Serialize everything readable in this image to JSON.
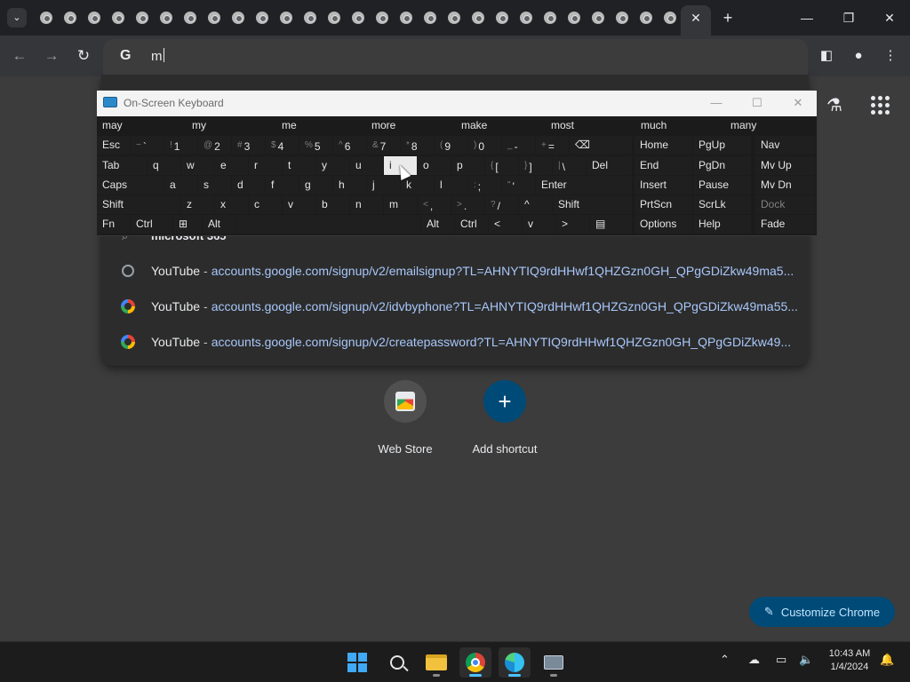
{
  "tabs": {
    "count": 27,
    "active_close": "✕",
    "new_tab": "+"
  },
  "window": {
    "minimize": "—",
    "maximize": "❐",
    "close": "✕"
  },
  "omnibox": {
    "text": "m"
  },
  "suggestions": [
    {
      "icon": "globe",
      "title": "YouTube",
      "sep": "-",
      "url": "accounts.google.com/signup/v2/emailsignup?TL=AHNYTIQ9rdHHwf1QHZGzn0GH_QPgGDiZkw49ma5..."
    },
    {
      "icon": "google",
      "title": "YouTube",
      "sep": "-",
      "url": "accounts.google.com/signup/v2/idvbyphone?TL=AHNYTIQ9rdHHwf1QHZGzn0GH_QPgGDiZkw49ma55..."
    },
    {
      "icon": "google",
      "title": "YouTube",
      "sep": "-",
      "url": "accounts.google.com/signup/v2/createpassword?TL=AHNYTIQ9rdHHwf1QHZGzn0GH_QPgGDiZkw49..."
    }
  ],
  "hidden_suggestion": "microsoft 365",
  "shortcuts": [
    {
      "label": "Web Store"
    },
    {
      "label": "Add shortcut"
    }
  ],
  "customize_label": "Customize Chrome",
  "osk": {
    "title": "On-Screen Keyboard",
    "predictions": [
      "may",
      "my",
      "me",
      "more",
      "make",
      "most",
      "much",
      "many"
    ],
    "row1": [
      {
        "k": "Esc"
      },
      {
        "s": "~",
        "m": "`"
      },
      {
        "s": "!",
        "m": "1"
      },
      {
        "s": "@",
        "m": "2"
      },
      {
        "s": "#",
        "m": "3"
      },
      {
        "s": "$",
        "m": "4"
      },
      {
        "s": "%",
        "m": "5"
      },
      {
        "s": "^",
        "m": "6"
      },
      {
        "s": "&",
        "m": "7"
      },
      {
        "s": "*",
        "m": "8"
      },
      {
        "s": "(",
        "m": "9"
      },
      {
        "s": ")",
        "m": "0"
      },
      {
        "s": "_",
        "m": "-"
      },
      {
        "s": "+",
        "m": "="
      },
      {
        "k": "⌫"
      }
    ],
    "row2": [
      {
        "k": "Tab"
      },
      {
        "k": "q"
      },
      {
        "k": "w"
      },
      {
        "k": "e"
      },
      {
        "k": "r"
      },
      {
        "k": "t"
      },
      {
        "k": "y"
      },
      {
        "k": "u"
      },
      {
        "k": "i"
      },
      {
        "k": "o"
      },
      {
        "k": "p"
      },
      {
        "s": "{",
        "m": "["
      },
      {
        "s": "}",
        "m": "]"
      },
      {
        "s": "|",
        "m": "\\"
      },
      {
        "k": "Del"
      }
    ],
    "row3": [
      {
        "k": "Caps"
      },
      {
        "k": "a"
      },
      {
        "k": "s"
      },
      {
        "k": "d"
      },
      {
        "k": "f"
      },
      {
        "k": "g"
      },
      {
        "k": "h"
      },
      {
        "k": "j"
      },
      {
        "k": "k"
      },
      {
        "k": "l"
      },
      {
        "s": ":",
        "m": ";"
      },
      {
        "s": "\"",
        "m": "'"
      },
      {
        "k": "Enter"
      }
    ],
    "row4": [
      {
        "k": "Shift"
      },
      {
        "k": "z"
      },
      {
        "k": "x"
      },
      {
        "k": "c"
      },
      {
        "k": "v"
      },
      {
        "k": "b"
      },
      {
        "k": "n"
      },
      {
        "k": "m"
      },
      {
        "s": "<",
        "m": ","
      },
      {
        "s": ">",
        "m": "."
      },
      {
        "s": "?",
        "m": "/"
      },
      {
        "k": "^"
      },
      {
        "k": "Shift"
      }
    ],
    "row5": [
      {
        "k": "Fn"
      },
      {
        "k": "Ctrl"
      },
      {
        "k": "⊞"
      },
      {
        "k": "Alt"
      },
      {
        "k": ""
      },
      {
        "k": "Alt"
      },
      {
        "k": "Ctrl"
      },
      {
        "k": "<"
      },
      {
        "k": "v"
      },
      {
        "k": ">"
      },
      {
        "k": "▤"
      }
    ],
    "nav": [
      [
        "Home",
        "PgUp",
        "Nav"
      ],
      [
        "End",
        "PgDn",
        "Mv Up"
      ],
      [
        "Insert",
        "Pause",
        "Mv Dn"
      ],
      [
        "PrtScn",
        "ScrLk",
        "Dock"
      ],
      [
        "Options",
        "Help",
        "Fade"
      ]
    ]
  },
  "clock": {
    "time": "10:43 AM",
    "date": "1/4/2024"
  }
}
